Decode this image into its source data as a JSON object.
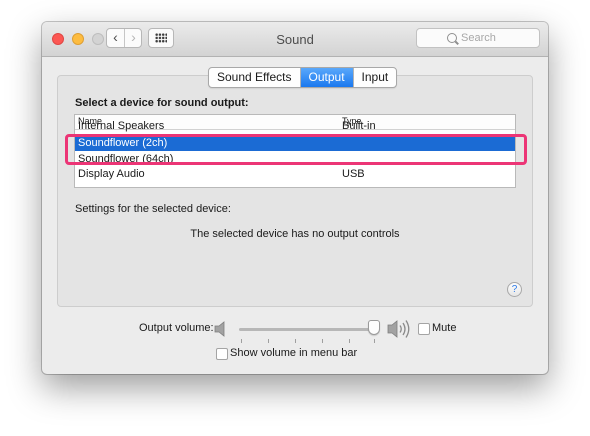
{
  "window": {
    "title": "Sound"
  },
  "search": {
    "placeholder": "Search"
  },
  "toolbar": {
    "back": "‹",
    "forward": "›"
  },
  "tabs": [
    {
      "label": "Sound Effects",
      "active": false
    },
    {
      "label": "Output",
      "active": true
    },
    {
      "label": "Input",
      "active": false
    }
  ],
  "output": {
    "select_label": "Select a device for sound output:",
    "columns": [
      "Name",
      "Type"
    ],
    "devices": [
      {
        "name": "Internal Speakers",
        "type": "Built-in",
        "selected": false
      },
      {
        "name": "Soundflower (2ch)",
        "type": "",
        "selected": true
      },
      {
        "name": "Soundflower (64ch)",
        "type": "",
        "selected": false
      },
      {
        "name": "Display Audio",
        "type": "USB",
        "selected": false
      }
    ],
    "settings_label": "Settings for the selected device:",
    "no_controls": "The selected device has no output controls"
  },
  "help": {
    "label": "?"
  },
  "volume": {
    "label": "Output volume:",
    "level": 0.95,
    "mute_label": "Mute",
    "mute_checked": false,
    "menu_bar_label": "Show volume in menu bar",
    "menu_bar_checked": false
  },
  "colors": {
    "selection": "#1b6bd4",
    "active_tab": "#1a78ef",
    "annotation": "#ec3576"
  }
}
